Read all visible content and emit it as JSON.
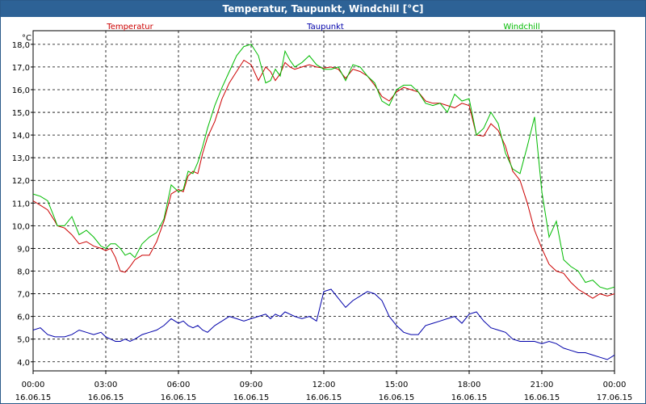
{
  "window": {
    "title": "Temperatur, Taupunkt, Windchill [°C]"
  },
  "chart_data": {
    "type": "line",
    "unit_label": "°C",
    "ylim": [
      3.6,
      18.6
    ],
    "yticks": [
      "4,0",
      "5,0",
      "6,0",
      "7,0",
      "8,0",
      "9,0",
      "10,0",
      "11,0",
      "12,0",
      "13,0",
      "14,0",
      "15,0",
      "16,0",
      "17,0",
      "18,0"
    ],
    "xlim": [
      0,
      24
    ],
    "xticks": [
      {
        "time": "00:00",
        "date": "16.06.15"
      },
      {
        "time": "03:00",
        "date": "16.06.15"
      },
      {
        "time": "06:00",
        "date": "16.06.15"
      },
      {
        "time": "09:00",
        "date": "16.06.15"
      },
      {
        "time": "12:00",
        "date": "16.06.15"
      },
      {
        "time": "15:00",
        "date": "16.06.15"
      },
      {
        "time": "18:00",
        "date": "16.06.15"
      },
      {
        "time": "21:00",
        "date": "16.06.15"
      },
      {
        "time": "00:00",
        "date": "17.06.15"
      }
    ],
    "grid": true,
    "series": [
      {
        "name": "Temperatur",
        "color": "#cc0000",
        "x": [
          0,
          0.3,
          0.6,
          0.9,
          1.0,
          1.3,
          1.6,
          1.9,
          2.2,
          2.5,
          2.8,
          3.0,
          3.2,
          3.4,
          3.6,
          3.8,
          4.0,
          4.2,
          4.5,
          4.8,
          5.1,
          5.4,
          5.7,
          6.0,
          6.2,
          6.4,
          6.6,
          6.8,
          7.0,
          7.2,
          7.5,
          7.8,
          8.1,
          8.4,
          8.7,
          9.0,
          9.3,
          9.6,
          9.8,
          10.0,
          10.2,
          10.4,
          10.6,
          10.8,
          11.1,
          11.4,
          11.7,
          12.0,
          12.3,
          12.6,
          12.9,
          13.2,
          13.5,
          13.8,
          14.1,
          14.4,
          14.7,
          15.0,
          15.3,
          15.6,
          15.9,
          16.2,
          16.5,
          16.8,
          17.1,
          17.4,
          17.7,
          18.0,
          18.3,
          18.6,
          18.9,
          19.2,
          19.5,
          19.8,
          20.1,
          20.4,
          20.7,
          21.0,
          21.3,
          21.6,
          21.9,
          22.2,
          22.5,
          22.8,
          23.1,
          23.4,
          23.7,
          24.0
        ],
        "values": [
          11.1,
          10.9,
          10.7,
          10.2,
          10.0,
          9.9,
          9.6,
          9.2,
          9.3,
          9.1,
          9.0,
          8.9,
          9.0,
          8.6,
          8.0,
          7.95,
          8.2,
          8.5,
          8.7,
          8.7,
          9.3,
          10.2,
          11.4,
          11.6,
          11.5,
          12.2,
          12.4,
          12.3,
          13.2,
          13.9,
          14.6,
          15.6,
          16.3,
          16.8,
          17.3,
          17.1,
          16.4,
          17.0,
          16.8,
          16.4,
          16.7,
          17.2,
          17.0,
          16.9,
          17.0,
          17.1,
          17.0,
          16.95,
          17.0,
          16.9,
          16.5,
          16.9,
          16.8,
          16.6,
          16.2,
          15.7,
          15.5,
          15.9,
          16.1,
          16.0,
          15.9,
          15.5,
          15.4,
          15.4,
          15.3,
          15.2,
          15.4,
          15.3,
          14.0,
          13.95,
          14.5,
          14.2,
          13.5,
          12.4,
          12.0,
          11.0,
          9.8,
          9.0,
          8.3,
          8.0,
          7.9,
          7.5,
          7.2,
          7.0,
          6.8,
          7.0,
          6.9,
          7.0
        ]
      },
      {
        "name": "Taupunkt",
        "color": "#0000aa",
        "x": [
          0,
          0.3,
          0.6,
          0.9,
          1.0,
          1.3,
          1.6,
          1.9,
          2.2,
          2.5,
          2.8,
          3.0,
          3.2,
          3.4,
          3.6,
          3.8,
          4.0,
          4.2,
          4.5,
          4.8,
          5.1,
          5.4,
          5.7,
          6.0,
          6.2,
          6.4,
          6.6,
          6.8,
          7.0,
          7.2,
          7.5,
          7.8,
          8.1,
          8.4,
          8.7,
          9.0,
          9.3,
          9.6,
          9.8,
          10.0,
          10.2,
          10.4,
          10.6,
          10.8,
          11.1,
          11.4,
          11.7,
          12.0,
          12.3,
          12.6,
          12.9,
          13.2,
          13.5,
          13.8,
          14.1,
          14.4,
          14.7,
          15.0,
          15.3,
          15.6,
          15.9,
          16.2,
          16.5,
          16.8,
          17.1,
          17.4,
          17.7,
          18.0,
          18.3,
          18.6,
          18.9,
          19.2,
          19.5,
          19.8,
          20.1,
          20.4,
          20.7,
          21.0,
          21.3,
          21.6,
          21.9,
          22.2,
          22.5,
          22.8,
          23.1,
          23.4,
          23.7,
          24.0
        ],
        "values": [
          5.4,
          5.5,
          5.2,
          5.1,
          5.1,
          5.1,
          5.2,
          5.4,
          5.3,
          5.2,
          5.3,
          5.1,
          5.0,
          4.9,
          4.9,
          5.0,
          4.9,
          5.0,
          5.2,
          5.3,
          5.4,
          5.6,
          5.9,
          5.7,
          5.8,
          5.6,
          5.5,
          5.6,
          5.4,
          5.3,
          5.6,
          5.8,
          6.0,
          5.9,
          5.8,
          5.9,
          6.0,
          6.1,
          5.9,
          6.1,
          6.0,
          6.2,
          6.1,
          6.0,
          5.9,
          6.0,
          5.8,
          7.1,
          7.2,
          6.8,
          6.4,
          6.7,
          6.9,
          7.1,
          7.0,
          6.7,
          6.0,
          5.6,
          5.3,
          5.2,
          5.2,
          5.6,
          5.7,
          5.8,
          5.9,
          6.0,
          5.7,
          6.1,
          6.2,
          5.8,
          5.5,
          5.4,
          5.3,
          5.0,
          4.9,
          4.9,
          4.9,
          4.8,
          4.9,
          4.8,
          4.6,
          4.5,
          4.4,
          4.4,
          4.3,
          4.2,
          4.1,
          4.3
        ]
      },
      {
        "name": "Windchill",
        "color": "#00bb00",
        "x": [
          0,
          0.3,
          0.6,
          0.9,
          1.0,
          1.3,
          1.6,
          1.9,
          2.2,
          2.5,
          2.8,
          3.0,
          3.2,
          3.4,
          3.6,
          3.8,
          4.0,
          4.2,
          4.5,
          4.8,
          5.1,
          5.4,
          5.7,
          6.0,
          6.2,
          6.4,
          6.6,
          6.8,
          7.0,
          7.2,
          7.5,
          7.8,
          8.1,
          8.4,
          8.7,
          9.0,
          9.3,
          9.6,
          9.8,
          10.0,
          10.2,
          10.4,
          10.6,
          10.8,
          11.1,
          11.4,
          11.7,
          12.0,
          12.3,
          12.6,
          12.9,
          13.2,
          13.5,
          13.8,
          14.1,
          14.4,
          14.7,
          15.0,
          15.3,
          15.6,
          15.9,
          16.2,
          16.5,
          16.8,
          17.1,
          17.4,
          17.7,
          18.0,
          18.3,
          18.6,
          18.9,
          19.2,
          19.5,
          19.8,
          20.1,
          20.4,
          20.7,
          21.0,
          21.3,
          21.6,
          21.9,
          22.2,
          22.5,
          22.8,
          23.1,
          23.4,
          23.7,
          24.0
        ],
        "values": [
          11.4,
          11.3,
          11.1,
          10.3,
          10.0,
          10.0,
          10.4,
          9.6,
          9.8,
          9.5,
          9.1,
          9.0,
          9.2,
          9.2,
          9.0,
          8.7,
          8.8,
          8.6,
          9.2,
          9.5,
          9.7,
          10.3,
          11.8,
          11.5,
          11.6,
          12.4,
          12.3,
          12.8,
          13.5,
          14.3,
          15.3,
          16.1,
          16.8,
          17.5,
          17.9,
          18.0,
          17.5,
          16.3,
          16.4,
          16.9,
          16.6,
          17.7,
          17.3,
          17.0,
          17.2,
          17.5,
          17.1,
          16.9,
          16.9,
          17.0,
          16.4,
          17.1,
          17.0,
          16.6,
          16.3,
          15.5,
          15.3,
          16.0,
          16.2,
          16.2,
          15.9,
          15.4,
          15.3,
          15.4,
          15.0,
          15.8,
          15.5,
          15.6,
          14.0,
          14.3,
          15.0,
          14.5,
          13.2,
          12.5,
          12.3,
          13.5,
          14.8,
          11.5,
          9.5,
          10.2,
          8.5,
          8.2,
          8.0,
          7.5,
          7.6,
          7.3,
          7.2,
          7.3
        ]
      }
    ]
  }
}
